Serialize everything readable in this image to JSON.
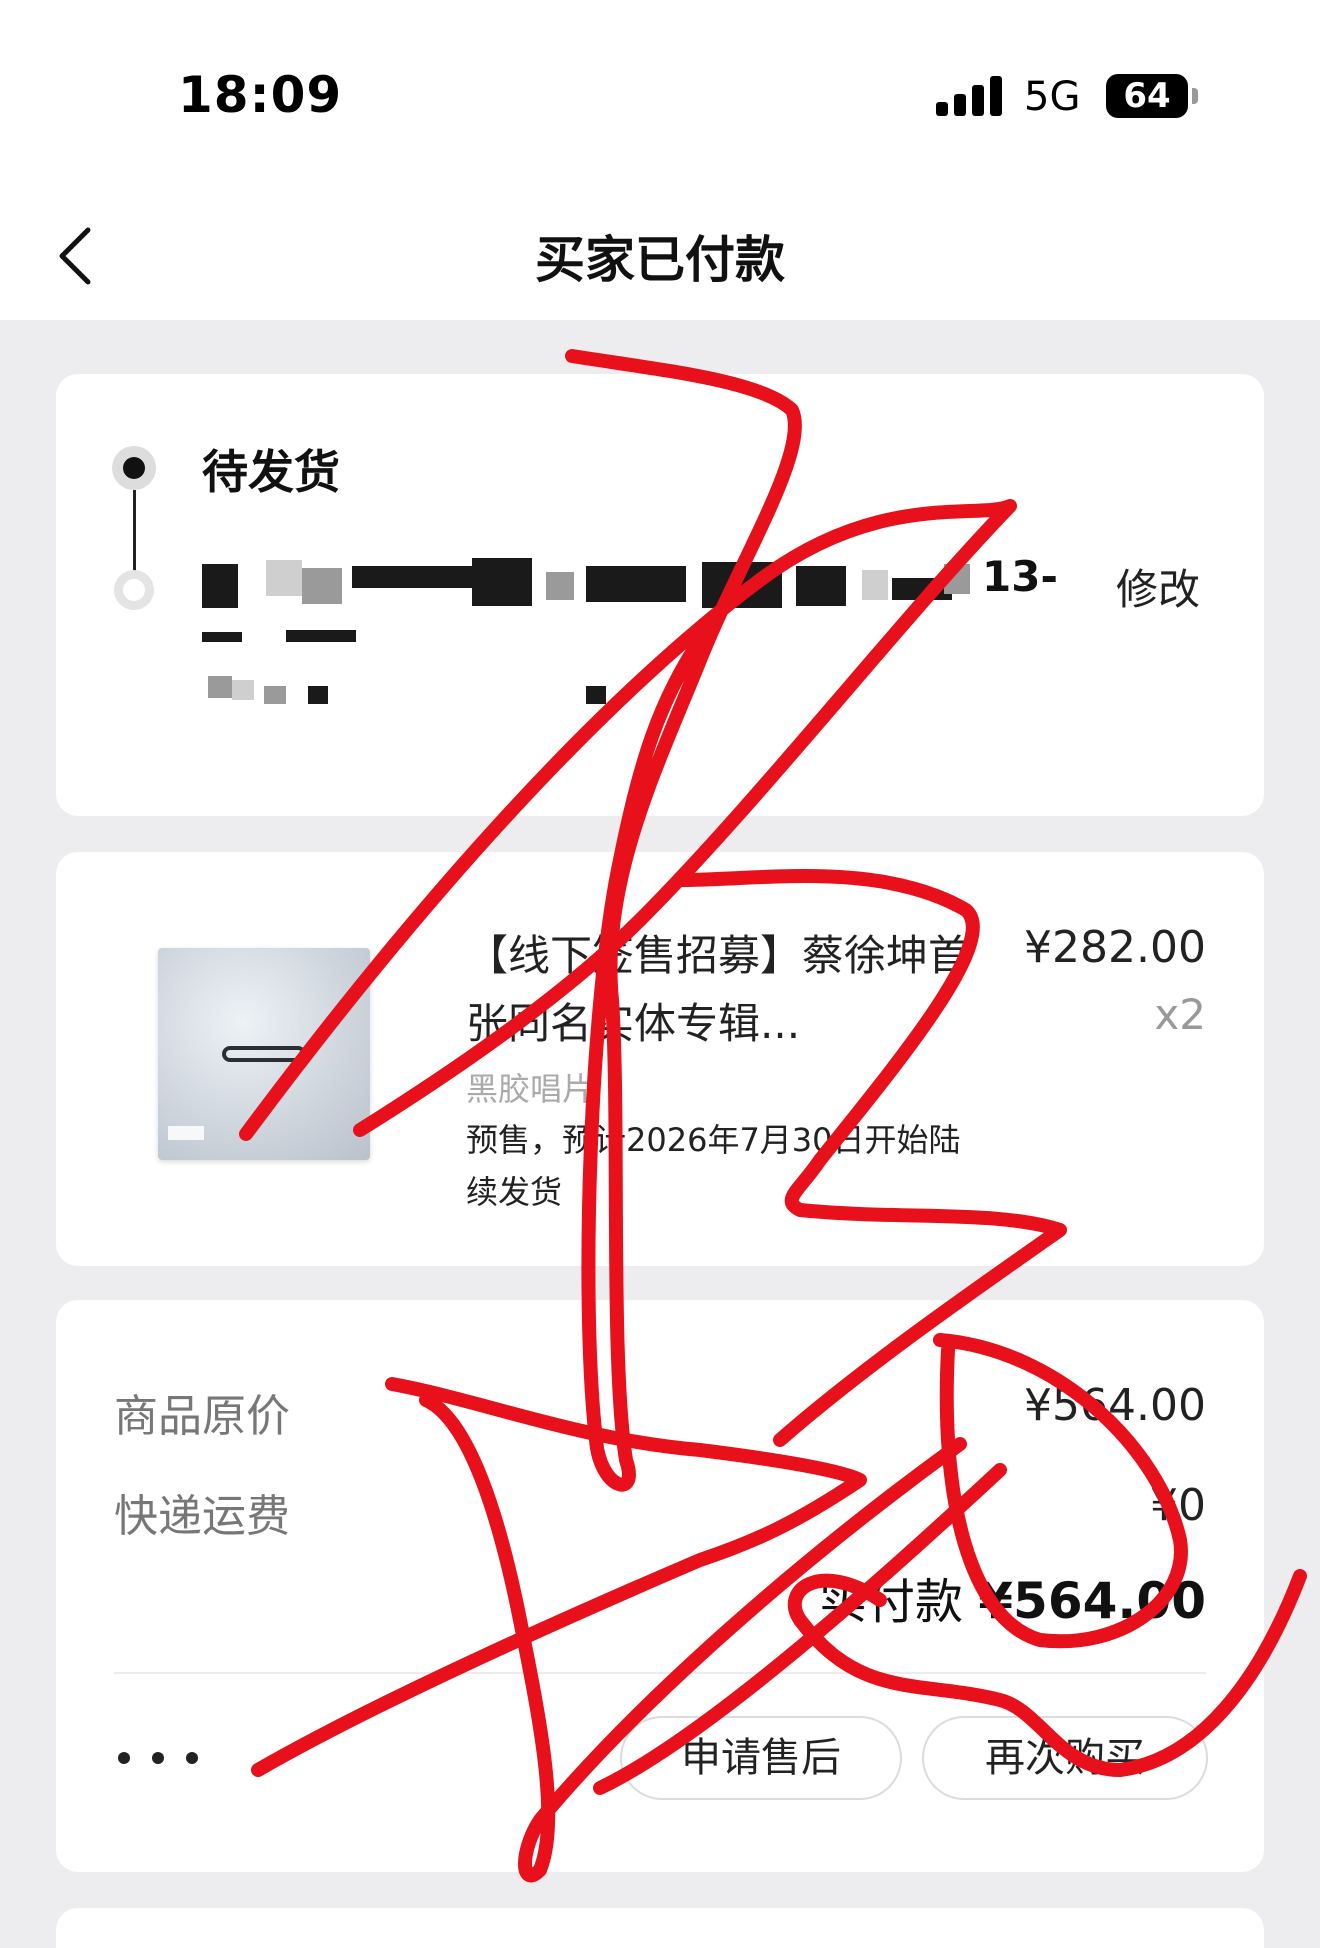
{
  "status_bar": {
    "time": "18:09",
    "network": "5G",
    "battery": "64"
  },
  "nav": {
    "title": "买家已付款"
  },
  "shipping": {
    "status": "待发货",
    "address_visible_tail": "13-",
    "edit_label": "修改"
  },
  "item": {
    "title": "【线下签售招募】蔡徐坤首张同名实体专辑...",
    "price": "¥282.00",
    "quantity": "x2",
    "type": "黑胶唱片",
    "note": "预售，预计2026年7月30日开始陆续发货"
  },
  "summary": {
    "original_label": "商品原价",
    "original_value": "¥564.00",
    "shipping_label": "快递运费",
    "shipping_value": "¥0",
    "paid_label": "实付款",
    "paid_value": "¥564.00"
  },
  "actions": {
    "after_sale": "申请售后",
    "rebuy": "再次购买"
  },
  "colors": {
    "scribble": "#e8101a",
    "background": "#ededf0",
    "card": "#ffffff"
  }
}
